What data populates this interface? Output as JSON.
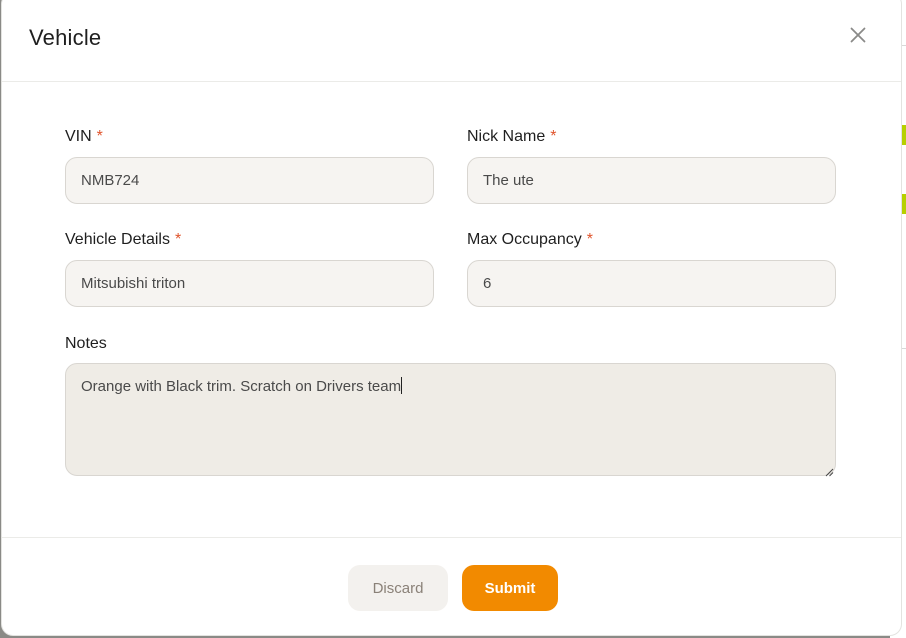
{
  "dialog": {
    "title": "Vehicle",
    "close_icon": "close-icon"
  },
  "form": {
    "required_marker": "*",
    "vin": {
      "label": "VIN",
      "value": "NMB724"
    },
    "nick_name": {
      "label": "Nick Name",
      "value": "The ute"
    },
    "vehicle_details": {
      "label": "Vehicle Details",
      "value": "Mitsubishi triton"
    },
    "max_occupancy": {
      "label": "Max Occupancy",
      "value": "6"
    },
    "notes": {
      "label": "Notes",
      "value": "Orange with Black trim. Scratch on Drivers team"
    }
  },
  "footer": {
    "discard_label": "Discard",
    "submit_label": "Submit"
  },
  "colors": {
    "accent": "#f28a00",
    "required": "#e0532b"
  }
}
